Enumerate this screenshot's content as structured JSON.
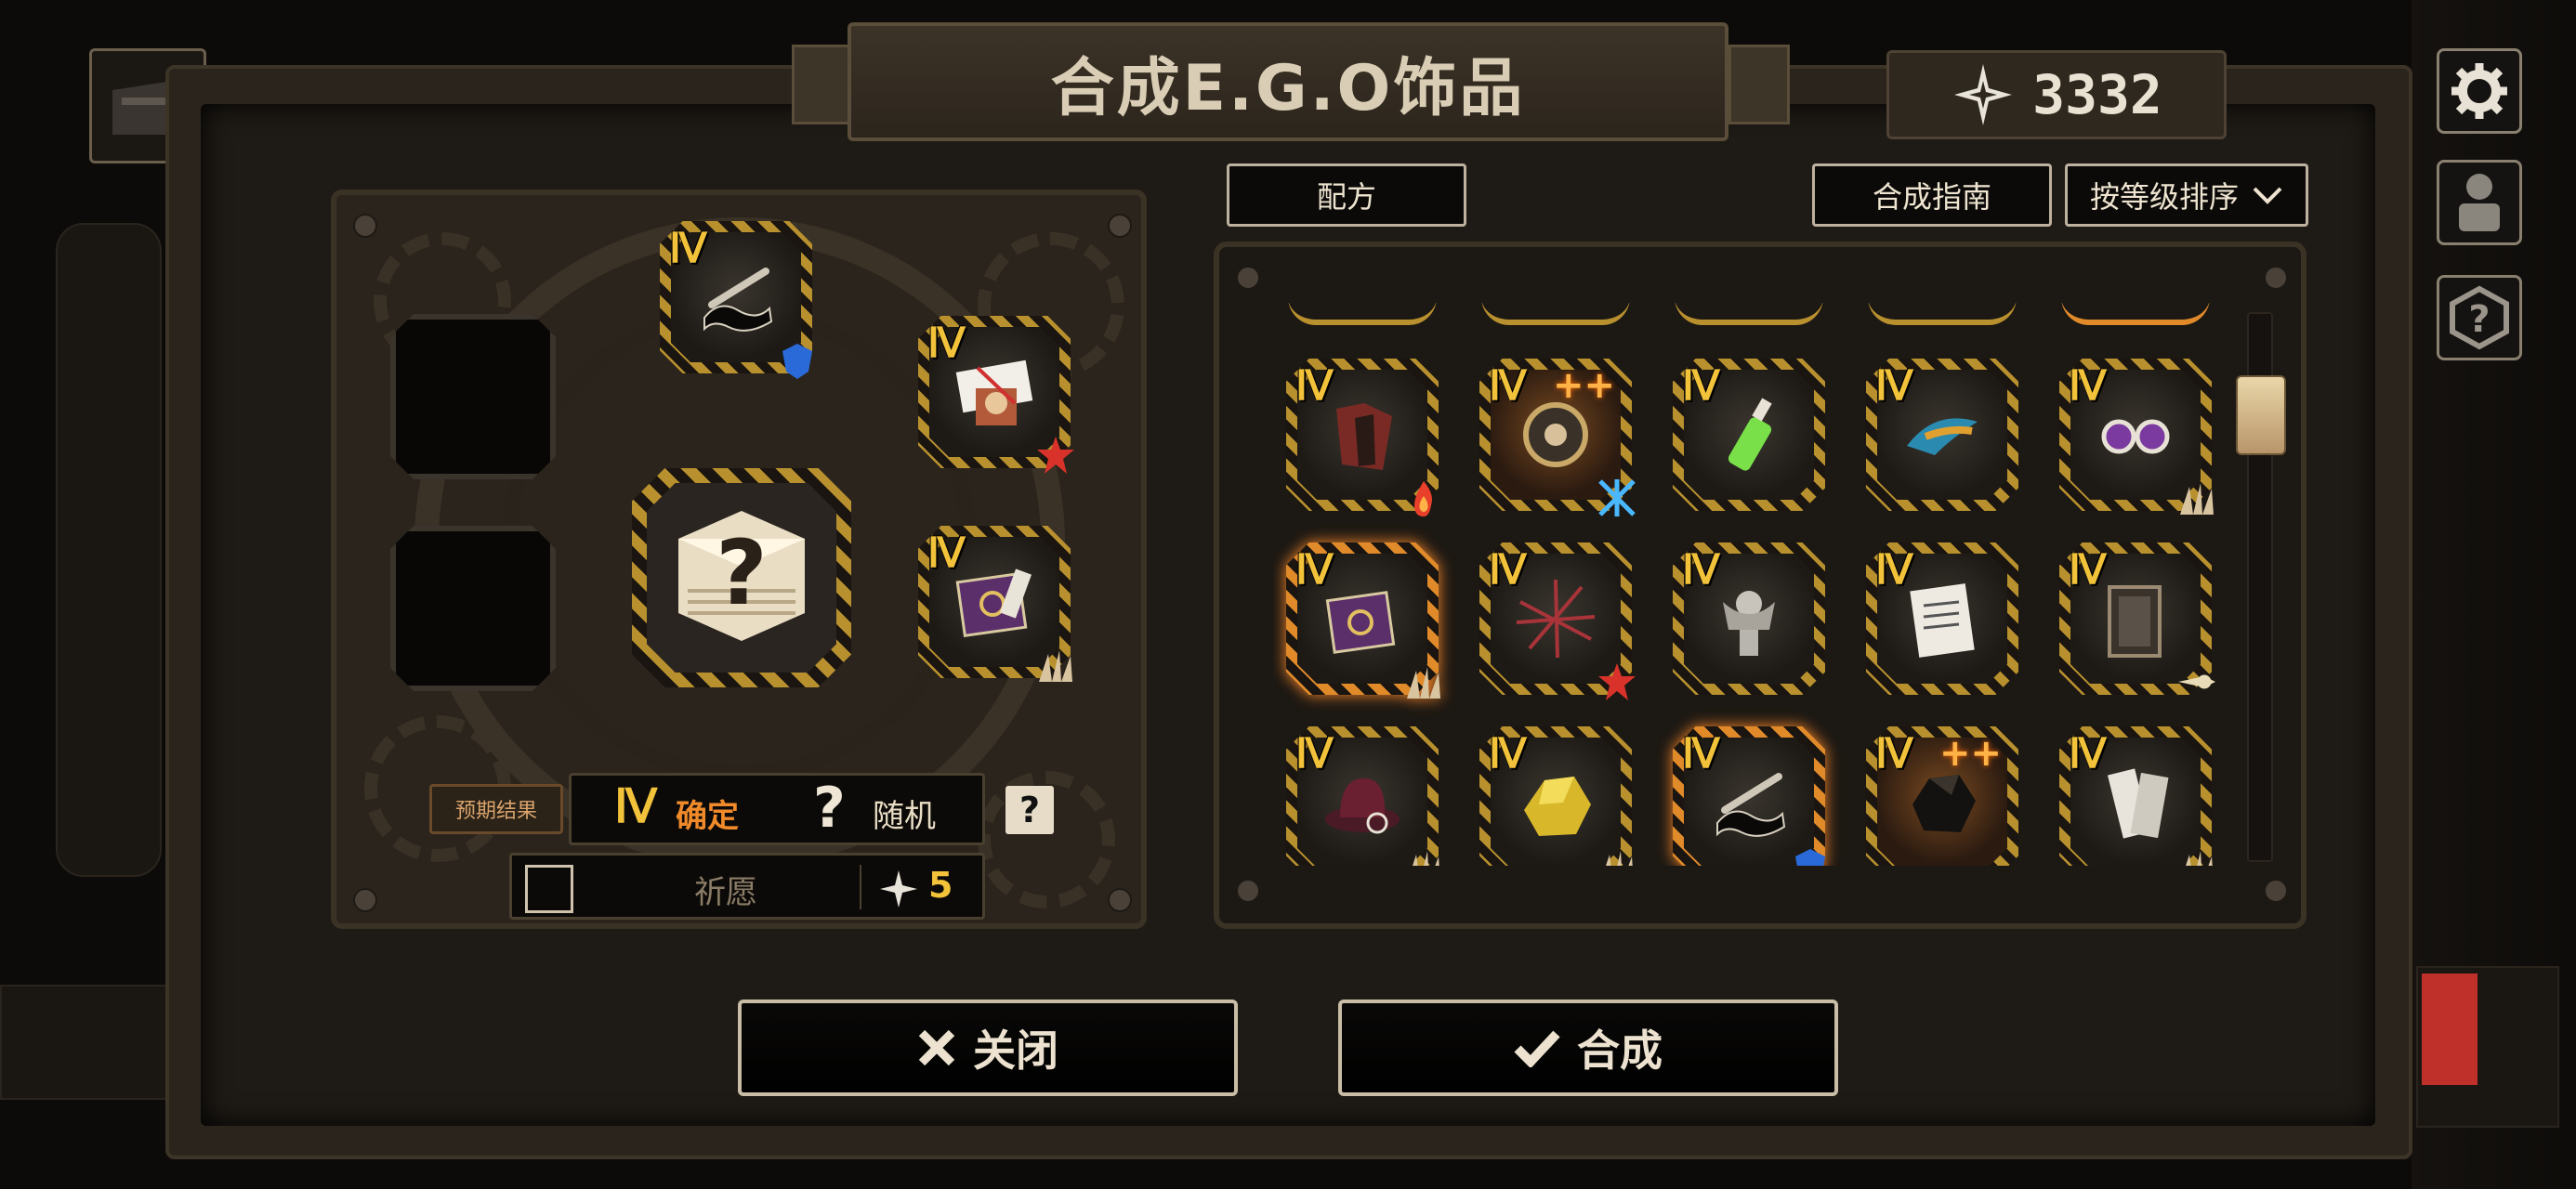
{
  "header": {
    "title": "合成E.G.O饰品",
    "currency_value": "3332"
  },
  "left_panel": {
    "prediction_label": "预期结果",
    "confirm_tier": "Ⅳ",
    "confirm_label": "确定",
    "random_symbol": "?",
    "random_label": "随机",
    "help_button": "?",
    "wish_label": "祈愿",
    "wish_cost": "5",
    "result_symbol": "?",
    "input_slots": [
      {
        "tier": "Ⅳ",
        "icon": "cigarette-holder-icon",
        "badge": "blue-crest-badge"
      },
      {
        "tier": "Ⅳ",
        "icon": "gift-box-icon",
        "badge": "red-burst-badge"
      },
      {
        "tier": "Ⅳ",
        "icon": "purple-book-icon",
        "badge": "claw-badge"
      }
    ]
  },
  "recipe_panel": {
    "recipe_tab": "配方",
    "guide_button": "合成指南",
    "sort_button": "按等级排序",
    "items": [
      {
        "tier": "Ⅳ",
        "icon": "red-cloth-icon",
        "badge": "flame-badge",
        "selected": false,
        "plus": ""
      },
      {
        "tier": "Ⅳ",
        "icon": "gear-clock-icon",
        "badge": "blue-star-badge",
        "selected": false,
        "plus": "++"
      },
      {
        "tier": "Ⅳ",
        "icon": "green-bottle-icon",
        "badge": "",
        "selected": false,
        "plus": ""
      },
      {
        "tier": "Ⅳ",
        "icon": "feather-icon",
        "badge": "",
        "selected": false,
        "plus": ""
      },
      {
        "tier": "Ⅳ",
        "icon": "sunglasses-icon",
        "badge": "claw-badge",
        "selected": false,
        "plus": ""
      },
      {
        "tier": "Ⅳ",
        "icon": "purple-book-icon",
        "badge": "claw-badge",
        "selected": true,
        "plus": ""
      },
      {
        "tier": "Ⅳ",
        "icon": "broken-glass-icon",
        "badge": "red-burst-badge",
        "selected": false,
        "plus": ""
      },
      {
        "tier": "Ⅳ",
        "icon": "statue-icon",
        "badge": "",
        "selected": false,
        "plus": ""
      },
      {
        "tier": "Ⅳ",
        "icon": "document-icon",
        "badge": "",
        "selected": false,
        "plus": ""
      },
      {
        "tier": "Ⅳ",
        "icon": "card-deck-icon",
        "badge": "pierce-badge",
        "selected": false,
        "plus": ""
      },
      {
        "tier": "Ⅳ",
        "icon": "hat-icon",
        "badge": "claw-badge",
        "selected": false,
        "plus": ""
      },
      {
        "tier": "Ⅳ",
        "icon": "gold-ore-icon",
        "badge": "claw-badge",
        "selected": false,
        "plus": ""
      },
      {
        "tier": "Ⅳ",
        "icon": "cigarette-holder-icon",
        "badge": "blue-crest-badge",
        "selected": true,
        "plus": ""
      },
      {
        "tier": "Ⅳ",
        "icon": "black-rock-icon",
        "badge": "",
        "selected": false,
        "plus": "++"
      },
      {
        "tier": "Ⅳ",
        "icon": "white-cards-icon",
        "badge": "claw-badge",
        "selected": false,
        "plus": ""
      }
    ]
  },
  "footer": {
    "close_label": "关闭",
    "craft_label": "合成"
  },
  "colors": {
    "accent_gold": "#f2c23a",
    "selected_orange": "#e08a2a",
    "panel": "#2b241c"
  }
}
